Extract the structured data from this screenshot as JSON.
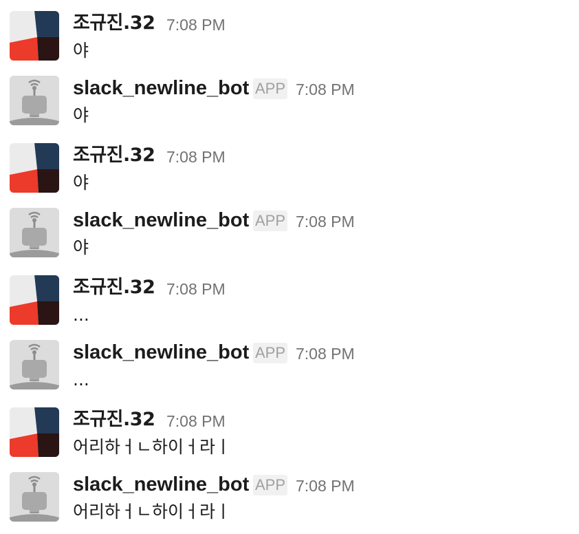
{
  "messages": [
    {
      "sender": "조규진.32",
      "is_app": false,
      "time": "7:08 PM",
      "text": "야"
    },
    {
      "sender": "slack_newline_bot",
      "is_app": true,
      "badge": "APP",
      "time": "7:08 PM",
      "text": "야"
    },
    {
      "sender": "조규진.32",
      "is_app": false,
      "time": "7:08 PM",
      "text": "야"
    },
    {
      "sender": "slack_newline_bot",
      "is_app": true,
      "badge": "APP",
      "time": "7:08 PM",
      "text": "야"
    },
    {
      "sender": "조규진.32",
      "is_app": false,
      "time": "7:08 PM",
      "text": "..."
    },
    {
      "sender": "slack_newline_bot",
      "is_app": true,
      "badge": "APP",
      "time": "7:08 PM",
      "text": "..."
    },
    {
      "sender": "조규진.32",
      "is_app": false,
      "time": "7:08 PM",
      "text": "어리하ㅓㄴ하이ㅓ라ㅣ"
    },
    {
      "sender": "slack_newline_bot",
      "is_app": true,
      "badge": "APP",
      "time": "7:08 PM",
      "text": "어리하ㅓㄴ하이ㅓ라ㅣ"
    }
  ],
  "avatars": {
    "user": {
      "icon": "user-avatar",
      "colors": [
        "#ebebeb",
        "#223a55",
        "#ec3a2b",
        "#2a1414"
      ]
    },
    "bot": {
      "icon": "bot-avatar",
      "colors": [
        "#dcdcdc",
        "#a9a9a9",
        "#8d8d8d"
      ]
    }
  }
}
